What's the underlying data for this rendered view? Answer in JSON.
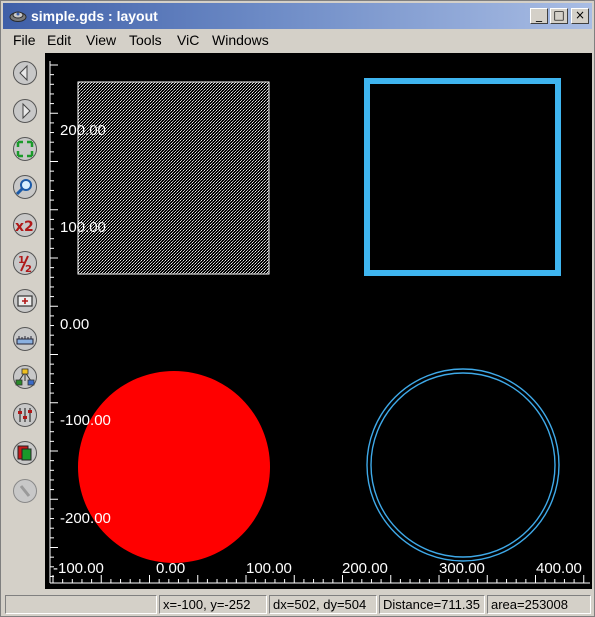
{
  "window": {
    "title": "simple.gds : layout",
    "minimize_glyph": "_",
    "maximize_glyph": "□",
    "close_glyph": "×"
  },
  "menu": {
    "items": [
      "File",
      "Edit",
      "View",
      "Tools",
      "ViC",
      "Windows"
    ]
  },
  "toolbar": {
    "tools": [
      {
        "name": "pan-left-icon"
      },
      {
        "name": "pan-right-icon"
      },
      {
        "name": "fit-all-icon"
      },
      {
        "name": "zoom-icon"
      },
      {
        "name": "zoom-in-x2-icon",
        "label": "x2"
      },
      {
        "name": "zoom-out-half-icon",
        "label": "½"
      },
      {
        "name": "zoom-box-icon"
      },
      {
        "name": "ruler-icon"
      },
      {
        "name": "hierarchy-icon"
      },
      {
        "name": "layers-sliders-icon"
      },
      {
        "name": "layer-palette-icon"
      },
      {
        "name": "tool-disabled-icon"
      }
    ]
  },
  "canvas": {
    "background": "#000000",
    "x_labels": [
      "-100.00",
      "0.00",
      "100.00",
      "200.00",
      "300.00",
      "400.00"
    ],
    "y_labels": [
      "200.00",
      "100.00",
      "0.00",
      "-100.00",
      "-200.00"
    ],
    "colors": {
      "hatched_square": "#ffffff",
      "outline_square": "#3fb5f0",
      "filled_circle": "#ff0000",
      "outline_circle": "#3fa9e8"
    }
  },
  "status": {
    "message": "",
    "coords": "x=-100, y=-252",
    "delta": "dx=502, dy=504",
    "distance": "Distance=711.35",
    "area": "area=253008"
  }
}
